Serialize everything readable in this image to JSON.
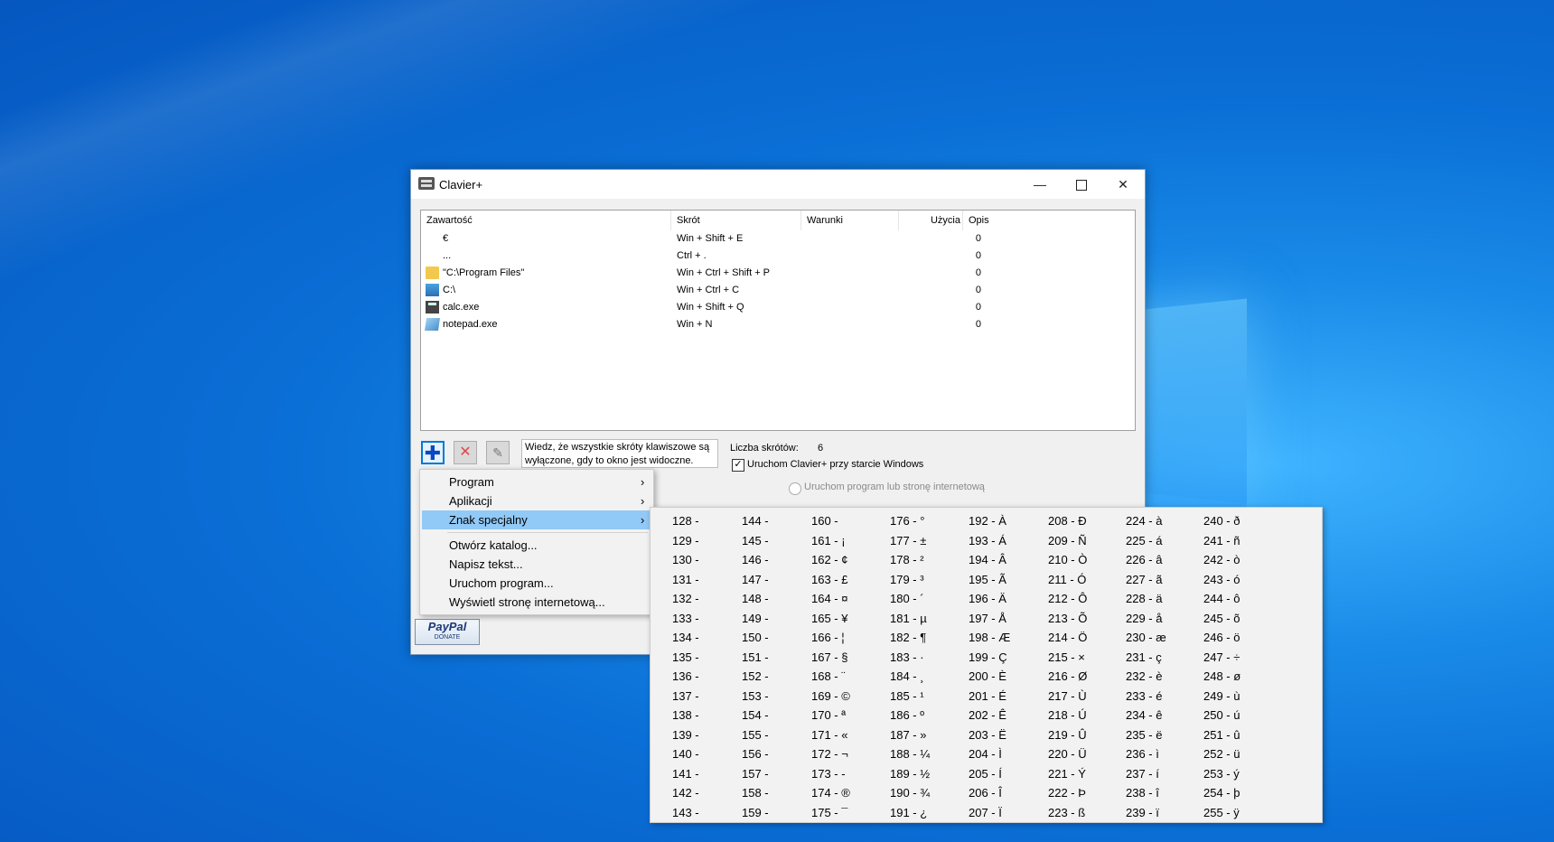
{
  "window": {
    "title": "Clavier+",
    "minimize_glyph": "—",
    "close_glyph": "✕"
  },
  "list": {
    "headers": [
      "Zawartość",
      "Skrót",
      "Warunki",
      "Użycia",
      "Opis"
    ],
    "rows": [
      {
        "content": "€",
        "shortcut": "Win + Shift + E",
        "conditions": "",
        "uses": "0",
        "description": "",
        "icon": "none"
      },
      {
        "content": "...",
        "shortcut": "Ctrl + .",
        "conditions": "",
        "uses": "0",
        "description": "",
        "icon": "none"
      },
      {
        "content": "\"C:\\Program Files\"",
        "shortcut": "Win + Ctrl + Shift + P",
        "conditions": "",
        "uses": "0",
        "description": "",
        "icon": "folder-icon"
      },
      {
        "content": "C:\\",
        "shortcut": "Win + Ctrl + C",
        "conditions": "",
        "uses": "0",
        "description": "",
        "icon": "drive-icon"
      },
      {
        "content": "calc.exe",
        "shortcut": "Win + Shift + Q",
        "conditions": "",
        "uses": "0",
        "description": "",
        "icon": "calculator-icon"
      },
      {
        "content": "notepad.exe",
        "shortcut": "Win + N",
        "conditions": "",
        "uses": "0",
        "description": "",
        "icon": "notepad-icon"
      }
    ]
  },
  "toolbar": {
    "add_glyph": "✚",
    "delete_glyph": "✕",
    "edit_glyph": "✎",
    "info_text": "Wiedz, że wszystkie skróty klawiszowe są wyłączone, gdy to okno jest widoczne.",
    "count_label": "Liczba skrótów:",
    "count_value": "6",
    "autostart_label": "Uruchom Clavier+ przy starcie Windows",
    "autostart_checked": "✓",
    "run_program_label": "Uruchom program lub stronę internetową"
  },
  "paypal": {
    "brand": "PayPal",
    "action": "DONATE"
  },
  "menu": {
    "items": [
      {
        "label": "Program",
        "arrow": "›"
      },
      {
        "label": "Aplikacji",
        "arrow": "›"
      },
      {
        "label": "Znak specjalny",
        "arrow": "›"
      },
      {
        "label": "Otwórz katalog..."
      },
      {
        "label": "Napisz tekst..."
      },
      {
        "label": "Uruchom program..."
      },
      {
        "label": "Wyświetl stronę internetową..."
      }
    ]
  },
  "special_chars": {
    "columns": [
      [
        "128 -",
        "129 -",
        "130 -",
        "131 -",
        "132 -",
        "133 -",
        "134 -",
        "135 -",
        "136 -",
        "137 -",
        "138 -",
        "139 -",
        "140 -",
        "141 -",
        "142 -",
        "143 -"
      ],
      [
        "144 -",
        "145 -",
        "146 -",
        "147 -",
        "148 -",
        "149 -",
        "150 -",
        "151 -",
        "152 -",
        "153 -",
        "154 -",
        "155 -",
        "156 -",
        "157 -",
        "158 -",
        "159 -"
      ],
      [
        "160 -",
        "161 - ¡",
        "162 - ¢",
        "163 - £",
        "164 - ¤",
        "165 - ¥",
        "166 - ¦",
        "167 - §",
        "168 - ¨",
        "169 - ©",
        "170 - ª",
        "171 - «",
        "172 - ¬",
        "173 - -",
        "174 - ®",
        "175 - ¯"
      ],
      [
        "176 - °",
        "177 - ±",
        "178 - ²",
        "179 - ³",
        "180 - ´",
        "181 - µ",
        "182 - ¶",
        "183 - ·",
        "184 - ¸",
        "185 - ¹",
        "186 - º",
        "187 - »",
        "188 - ¼",
        "189 - ½",
        "190 - ¾",
        "191 - ¿"
      ],
      [
        "192 - À",
        "193 - Á",
        "194 - Â",
        "195 - Ã",
        "196 - Ä",
        "197 - Å",
        "198 - Æ",
        "199 - Ç",
        "200 - È",
        "201 - É",
        "202 - Ê",
        "203 - Ë",
        "204 - Ì",
        "205 - Í",
        "206 - Î",
        "207 - Ï"
      ],
      [
        "208 - Ð",
        "209 - Ñ",
        "210 - Ò",
        "211 - Ó",
        "212 - Ô",
        "213 - Õ",
        "214 - Ö",
        "215 - ×",
        "216 - Ø",
        "217 - Ù",
        "218 - Ú",
        "219 - Û",
        "220 - Ü",
        "221 - Ý",
        "222 - Þ",
        "223 - ß"
      ],
      [
        "224 - à",
        "225 - á",
        "226 - â",
        "227 - ã",
        "228 - ä",
        "229 - å",
        "230 - æ",
        "231 - ç",
        "232 - è",
        "233 - é",
        "234 - ê",
        "235 - ë",
        "236 - ì",
        "237 - í",
        "238 - î",
        "239 - ï"
      ],
      [
        "240 - ð",
        "241 - ñ",
        "242 - ò",
        "243 - ó",
        "244 - ô",
        "245 - õ",
        "246 - ö",
        "247 - ÷",
        "248 - ø",
        "249 - ù",
        "250 - ú",
        "251 - û",
        "252 - ü",
        "253 - ý",
        "254 - þ",
        "255 - ÿ"
      ]
    ]
  }
}
